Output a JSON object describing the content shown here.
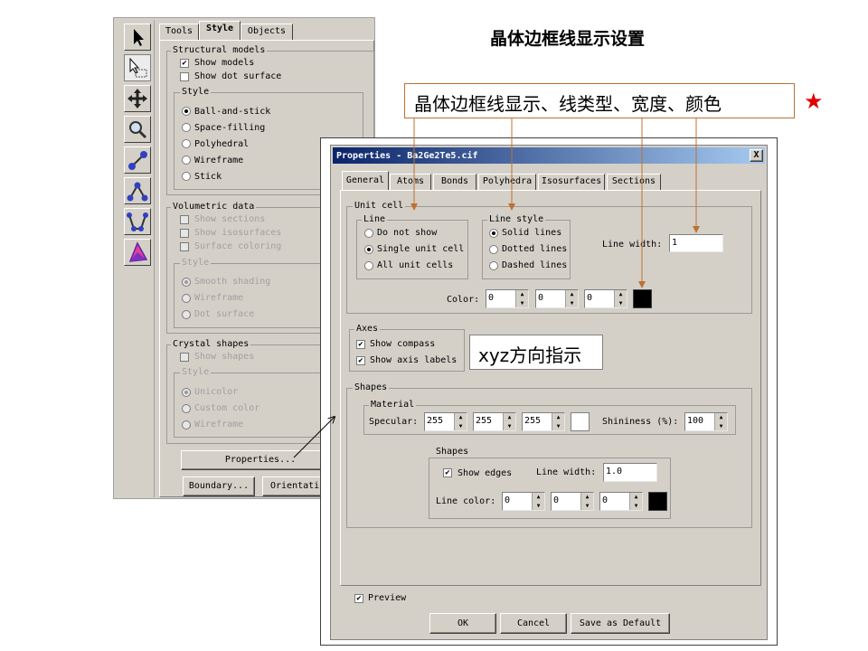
{
  "slide": {
    "title": "晶体边框线显示设置",
    "callout_top": "晶体边框线显示、线类型、宽度、颜色",
    "callout_axes": "xyz方向指示",
    "star": "★"
  },
  "left_panel": {
    "tabs": [
      "Tools",
      "Style",
      "Objects"
    ],
    "structural_models": {
      "title": "Structural models",
      "show_models": "Show models",
      "show_dot_surface": "Show dot surface"
    },
    "style": {
      "title": "Style",
      "options": [
        "Ball-and-stick",
        "Space-filling",
        "Polyhedral",
        "Wireframe",
        "Stick"
      ]
    },
    "volumetric": {
      "title": "Volumetric data",
      "checks": [
        "Show sections",
        "Show isosurfaces",
        "Surface coloring"
      ],
      "style_title": "Style",
      "options": [
        "Smooth shading",
        "Wireframe",
        "Dot surface"
      ]
    },
    "crystal_shapes": {
      "title": "Crystal shapes",
      "show_shapes": "Show shapes",
      "style_title": "Style",
      "options": [
        "Unicolor",
        "Custom color",
        "Wireframe"
      ]
    },
    "buttons": {
      "properties": "Properties...",
      "boundary": "Boundary...",
      "orientation": "Orientati"
    }
  },
  "dialog": {
    "title": "Properties - Ba2Ge2Te5.cif",
    "close": "X",
    "tabs": [
      "General",
      "Atoms",
      "Bonds",
      "Polyhedra",
      "Isosurfaces",
      "Sections"
    ],
    "unit_cell": {
      "title": "Unit cell",
      "line_title": "Line",
      "line_options": [
        "Do not show",
        "Single unit cell",
        "All unit cells"
      ],
      "style_title": "Line style",
      "style_options": [
        "Solid lines",
        "Dotted lines",
        "Dashed lines"
      ],
      "line_width_label": "Line width:",
      "line_width_value": "1",
      "color_label": "Color:",
      "color_values": [
        "0",
        "0",
        "0"
      ],
      "color_swatch": "#000000"
    },
    "axes": {
      "title": "Axes",
      "show_compass": "Show compass",
      "show_axis_labels": "Show axis labels"
    },
    "shapes": {
      "title": "Shapes",
      "material_title": "Material",
      "specular_label": "Specular:",
      "specular_values": [
        "255",
        "255",
        "255"
      ],
      "specular_swatch": "#ffffff",
      "shininess_label": "Shininess (%):",
      "shininess_value": "100",
      "inner_title": "Shapes",
      "show_edges": "Show edges",
      "line_width_label": "Line width:",
      "line_width_value": "1.0",
      "line_color_label": "Line color:",
      "line_color_values": [
        "0",
        "0",
        "0"
      ],
      "line_color_swatch": "#000000"
    },
    "preview": "Preview",
    "ok": "OK",
    "cancel": "Cancel",
    "save_default": "Save as Default"
  },
  "colors": {
    "window_bg": "#d4d0c8",
    "titlebar_start": "#0a246a",
    "titlebar_end": "#a6caf0",
    "annotation_line": "#c07030",
    "star": "#e00000"
  }
}
